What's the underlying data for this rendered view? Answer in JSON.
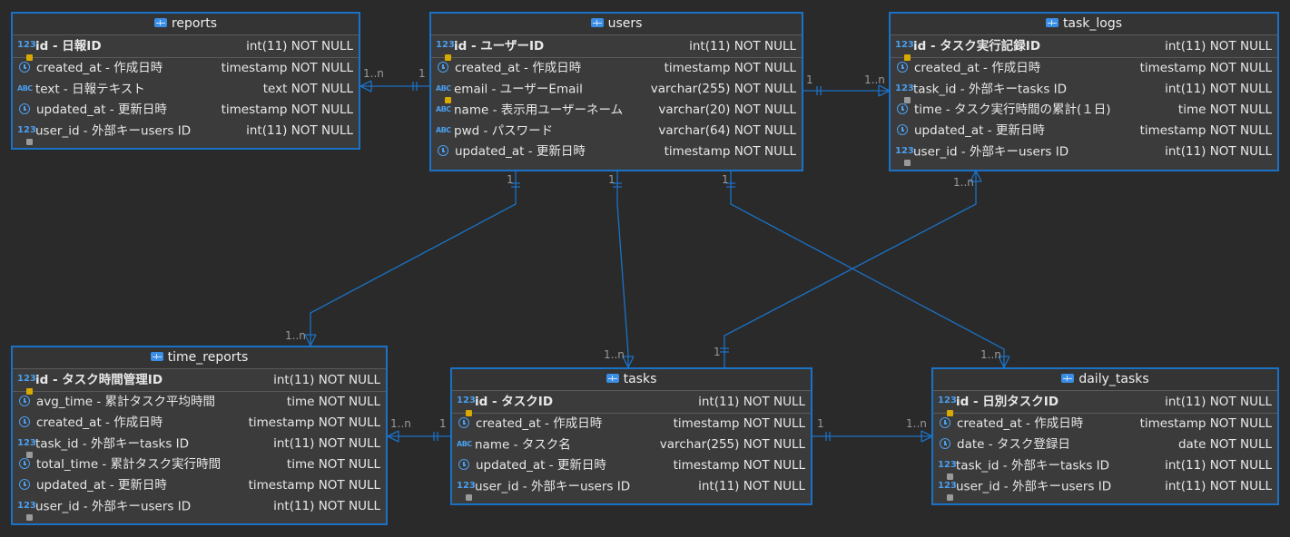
{
  "diagram_title": "",
  "accent_color": "#1a72c7",
  "tables": {
    "reports": {
      "name": "reports",
      "pk": {
        "label": "id - 日報ID",
        "type": "int(11) NOT NULL"
      },
      "columns": [
        {
          "icon": "clock-icon",
          "label": "created_at - 作成日時",
          "type": "timestamp NOT NULL"
        },
        {
          "icon": "text-type-icon",
          "label": "text - 日報テキスト",
          "type": "text NOT NULL"
        },
        {
          "icon": "clock-icon",
          "label": "updated_at - 更新日時",
          "type": "timestamp NOT NULL"
        },
        {
          "icon": "foreign-key-icon",
          "label": "user_id - 外部キーusers ID",
          "type": "int(11) NOT NULL"
        }
      ]
    },
    "users": {
      "name": "users",
      "pk": {
        "label": "id - ユーザーID",
        "type": "int(11) NOT NULL"
      },
      "columns": [
        {
          "icon": "clock-icon",
          "label": "created_at - 作成日時",
          "type": "timestamp NOT NULL"
        },
        {
          "icon": "text-key-icon",
          "label": "email - ユーザーEmail",
          "type": "varchar(255) NOT NULL"
        },
        {
          "icon": "text-type-icon",
          "label": "name - 表示用ユーザーネーム",
          "type": "varchar(20) NOT NULL"
        },
        {
          "icon": "text-type-icon",
          "label": "pwd - パスワード",
          "type": "varchar(64) NOT NULL"
        },
        {
          "icon": "clock-icon",
          "label": "updated_at - 更新日時",
          "type": "timestamp NOT NULL"
        }
      ]
    },
    "task_logs": {
      "name": "task_logs",
      "pk": {
        "label": "id - タスク実行記録ID",
        "type": "int(11) NOT NULL"
      },
      "columns": [
        {
          "icon": "clock-icon",
          "label": "created_at - 作成日時",
          "type": "timestamp NOT NULL"
        },
        {
          "icon": "foreign-key-icon",
          "label": "task_id - 外部キーtasks ID",
          "type": "int(11) NOT NULL"
        },
        {
          "icon": "clock-icon",
          "label": "time - タスク実行時間の累計(１日)",
          "type": "time NOT NULL"
        },
        {
          "icon": "clock-icon",
          "label": "updated_at - 更新日時",
          "type": "timestamp NOT NULL"
        },
        {
          "icon": "foreign-key-icon",
          "label": "user_id - 外部キーusers ID",
          "type": "int(11) NOT NULL"
        }
      ]
    },
    "time_reports": {
      "name": "time_reports",
      "pk": {
        "label": "id - タスク時間管理ID",
        "type": "int(11) NOT NULL"
      },
      "columns": [
        {
          "icon": "clock-icon",
          "label": "avg_time - 累計タスク平均時間",
          "type": "time NOT NULL"
        },
        {
          "icon": "clock-icon",
          "label": "created_at - 作成日時",
          "type": "timestamp NOT NULL"
        },
        {
          "icon": "foreign-key-icon",
          "label": "task_id - 外部キーtasks ID",
          "type": "int(11) NOT NULL"
        },
        {
          "icon": "clock-icon",
          "label": "total_time - 累計タスク実行時間",
          "type": "time NOT NULL"
        },
        {
          "icon": "clock-icon",
          "label": "updated_at - 更新日時",
          "type": "timestamp NOT NULL"
        },
        {
          "icon": "foreign-key-icon",
          "label": "user_id - 外部キーusers ID",
          "type": "int(11) NOT NULL"
        }
      ]
    },
    "tasks": {
      "name": "tasks",
      "pk": {
        "label": "id - タスクID",
        "type": "int(11) NOT NULL"
      },
      "columns": [
        {
          "icon": "clock-icon",
          "label": "created_at - 作成日時",
          "type": "timestamp NOT NULL"
        },
        {
          "icon": "text-type-icon",
          "label": "name - タスク名",
          "type": "varchar(255) NOT NULL"
        },
        {
          "icon": "clock-icon",
          "label": "updated_at - 更新日時",
          "type": "timestamp NOT NULL"
        },
        {
          "icon": "foreign-key-icon",
          "label": "user_id - 外部キーusers ID",
          "type": "int(11) NOT NULL"
        }
      ]
    },
    "daily_tasks": {
      "name": "daily_tasks",
      "pk": {
        "label": "id - 日別タスクID",
        "type": "int(11) NOT NULL"
      },
      "columns": [
        {
          "icon": "clock-icon",
          "label": "created_at - 作成日時",
          "type": "timestamp NOT NULL"
        },
        {
          "icon": "clock-icon",
          "label": "date - タスク登録日",
          "type": "date NOT NULL"
        },
        {
          "icon": "foreign-key-icon",
          "label": "task_id - 外部キーtasks ID",
          "type": "int(11) NOT NULL"
        },
        {
          "icon": "foreign-key-icon",
          "label": "user_id - 外部キーusers ID",
          "type": "int(11) NOT NULL"
        }
      ]
    }
  },
  "relationships": [
    {
      "from": "users",
      "to": "reports",
      "one": "1",
      "many": "1..n"
    },
    {
      "from": "users",
      "to": "task_logs",
      "one": "1",
      "many": "1..n"
    },
    {
      "from": "users",
      "to": "time_reports",
      "one": "1",
      "many": "1..n"
    },
    {
      "from": "users",
      "to": "tasks",
      "one": "1",
      "many": "1..n"
    },
    {
      "from": "users",
      "to": "daily_tasks",
      "one": "1",
      "many": "1..n"
    },
    {
      "from": "tasks",
      "to": "task_logs",
      "one": "1",
      "many": "1..n"
    },
    {
      "from": "tasks",
      "to": "time_reports",
      "one": "1",
      "many": "1..n"
    },
    {
      "from": "tasks",
      "to": "daily_tasks",
      "one": "1",
      "many": "1..n"
    }
  ]
}
